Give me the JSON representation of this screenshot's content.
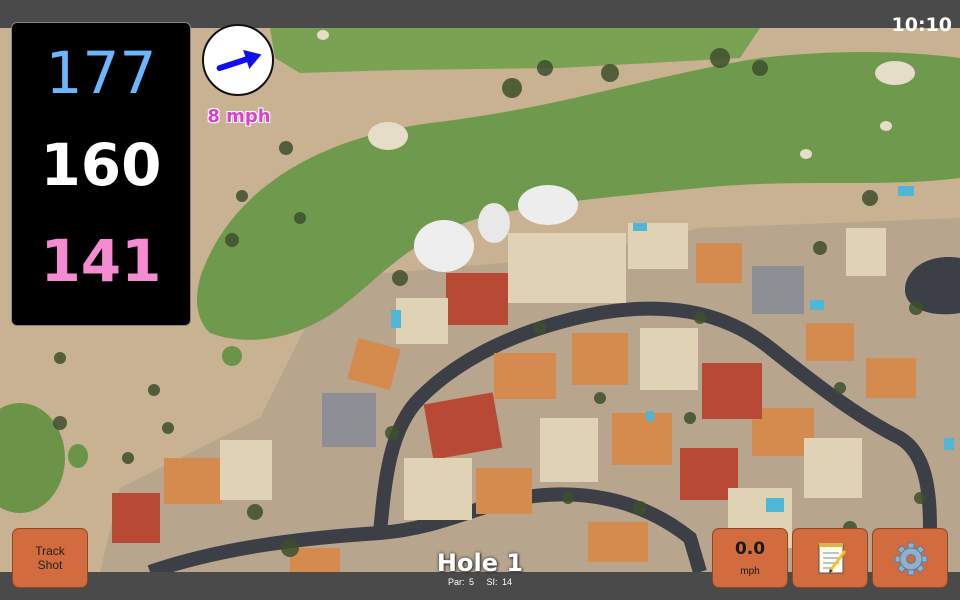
{
  "status_bar": {
    "time": "10:10"
  },
  "distances": {
    "back": "177",
    "center": "160",
    "front": "141"
  },
  "wind": {
    "speed_text": "8 mph",
    "direction_icon": "arrow-right-up-icon"
  },
  "track_shot": {
    "line1": "Track",
    "line2": "Shot"
  },
  "shot_speed": {
    "value": "0.0",
    "unit": "mph"
  },
  "notes_button": {
    "icon": "notepad-icon"
  },
  "settings_button": {
    "icon": "gear-icon"
  },
  "hole": {
    "title": "Hole 1",
    "par_label": "Par: 5",
    "si_label": "SI: 14"
  },
  "colors": {
    "back_distance": "#6cb6ff",
    "center_distance": "#ffffff",
    "front_distance": "#f58bd0",
    "wind_text": "#d943c8",
    "arrow": "#1010ee",
    "button_bg": "#d26b3d",
    "fairway": "#6d9a4f",
    "sand": "#c9b394",
    "road": "#3c3f45"
  }
}
